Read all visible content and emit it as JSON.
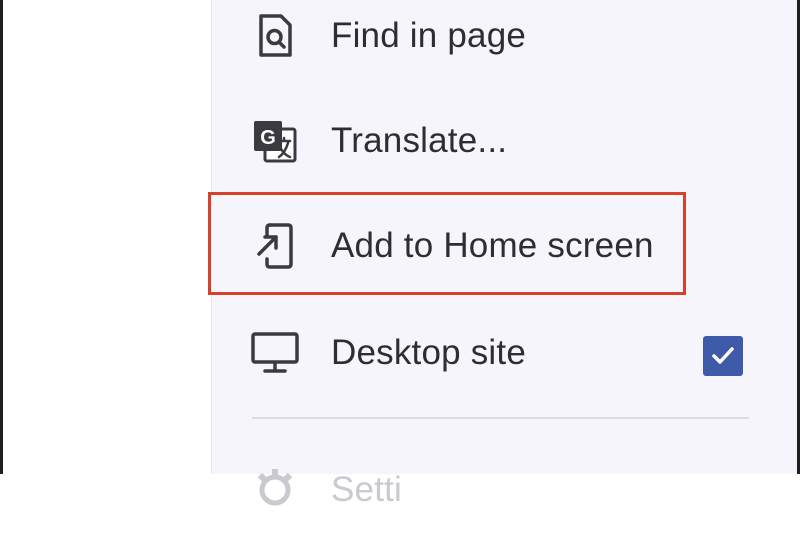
{
  "menu": {
    "items": [
      {
        "label": "Find in page",
        "icon": "find-in-page-icon"
      },
      {
        "label": "Translate...",
        "icon": "translate-icon"
      },
      {
        "label": "Add to Home screen",
        "icon": "add-to-home-screen-icon",
        "highlighted": true
      },
      {
        "label": "Desktop site",
        "icon": "desktop-icon",
        "checked": true
      },
      {
        "label": "Setti",
        "icon": "gear-icon"
      }
    ]
  },
  "colors": {
    "menu_bg": "#f5f5fb",
    "highlight": "#d6412a",
    "checkbox": "#3f5aa8",
    "text": "#2d2d33"
  }
}
